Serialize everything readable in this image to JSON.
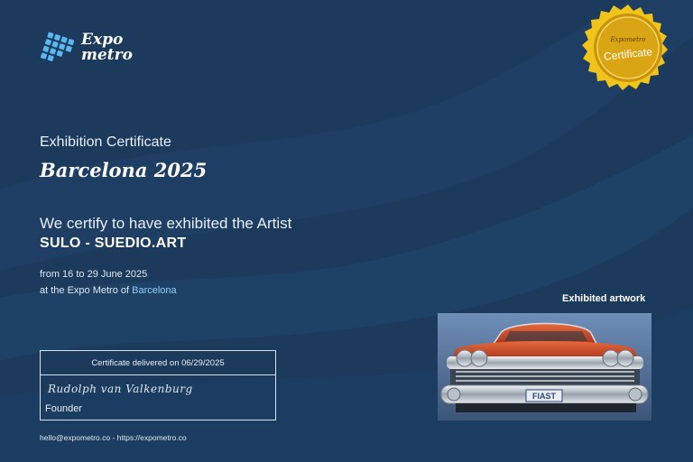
{
  "brand": {
    "line1": "Expo",
    "line2": "metro"
  },
  "seal": {
    "top": "Expometro",
    "main": "Certificate"
  },
  "certificate": {
    "title": "Exhibition Certificate",
    "city_title": "Barcelona 2025",
    "statement": "We certify to have exhibited the Artist",
    "artist": "SULO - SUEDIO.ART",
    "dates": "from 16 to 29 June 2025",
    "venue_prefix": "at the Expo Metro of ",
    "venue_city": "Barcelona"
  },
  "artwork": {
    "label": "Exhibited artwork",
    "plate": "FIAST"
  },
  "delivery": {
    "delivered": "Certificate delivered on 06/29/2025",
    "signature": "Rudolph van Valkenburg",
    "role": "Founder"
  },
  "footer": {
    "contact": "hello@expometro.co - https://expometro.co"
  },
  "colors": {
    "background": "#1b3a5c",
    "accent": "#8fd0ff",
    "seal_gold": "#e9b418"
  },
  "icons": [
    "grid-logo-icon",
    "gold-seal-icon"
  ]
}
